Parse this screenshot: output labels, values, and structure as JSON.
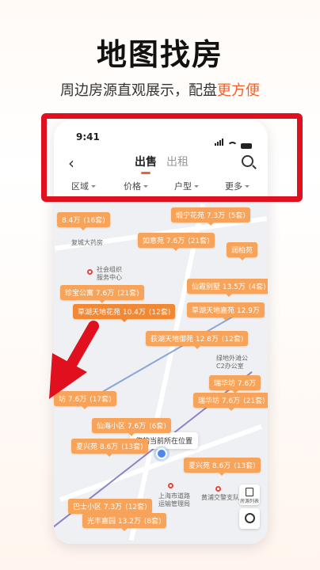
{
  "promo": {
    "headline": "地图找房",
    "subline_main": "周边房源直观展示，配盘",
    "subline_accent": "更方便"
  },
  "status_bar": {
    "time": "9:41"
  },
  "nav": {
    "back_icon": "chevron-left-icon",
    "tab_sale": "出售",
    "tab_rent": "出租",
    "search_icon": "search-icon"
  },
  "filters": [
    "区域",
    "价格",
    "户型",
    "更多"
  ],
  "map": {
    "pins": [
      {
        "label": "8.4万",
        "count": "(16套)"
      },
      {
        "label": "煅宁花苑 7.3万",
        "count": "(5套)"
      },
      {
        "label": "如意苑 7.6万",
        "count": "(21套)"
      },
      {
        "label": "润柏苑",
        "count": ""
      },
      {
        "label": "珍宝公寓 7.6万",
        "count": "(21套)"
      },
      {
        "label": "仙霞别墅 13.5万",
        "count": "(4套)"
      },
      {
        "label": "草湖天地花苑 10.4万",
        "count": "(12套)"
      },
      {
        "label": "草湖天地嘉苑 12.9万",
        "count": ""
      },
      {
        "label": "荻湖天地御苑 12.8万",
        "count": "(12套)"
      },
      {
        "label": "瑞华坊 7.6万",
        "count": ""
      },
      {
        "label": "坊 7.6万",
        "count": "(17套)"
      },
      {
        "label": "瑞华坊 7.6万",
        "count": "(21套)"
      },
      {
        "label": "仙海小区 7.6万",
        "count": "(6套)"
      },
      {
        "label": "夏兴苑 8.6万",
        "count": "(13套)"
      },
      {
        "label": "夏兴苑 8.6万",
        "count": "(13套)"
      },
      {
        "label": "巴士小区 7.3万",
        "count": "(12套)"
      },
      {
        "label": "光丰嘉园 13.2万",
        "count": "(8套)"
      }
    ],
    "pois": [
      {
        "name": "社会组织\n服务中心"
      },
      {
        "name": "上海市道路\n运输管理局"
      },
      {
        "name": "黄浦交警支队"
      },
      {
        "name": "绿地外滩公\nC2办公室"
      },
      {
        "name": "复城大药房"
      }
    ],
    "location_tip": "您的当前所在位置",
    "fab_list_label": "房源列表"
  },
  "colors": {
    "accent": "#f0622a",
    "pin": "#f7a35a",
    "highlight_box": "#e0101e"
  }
}
